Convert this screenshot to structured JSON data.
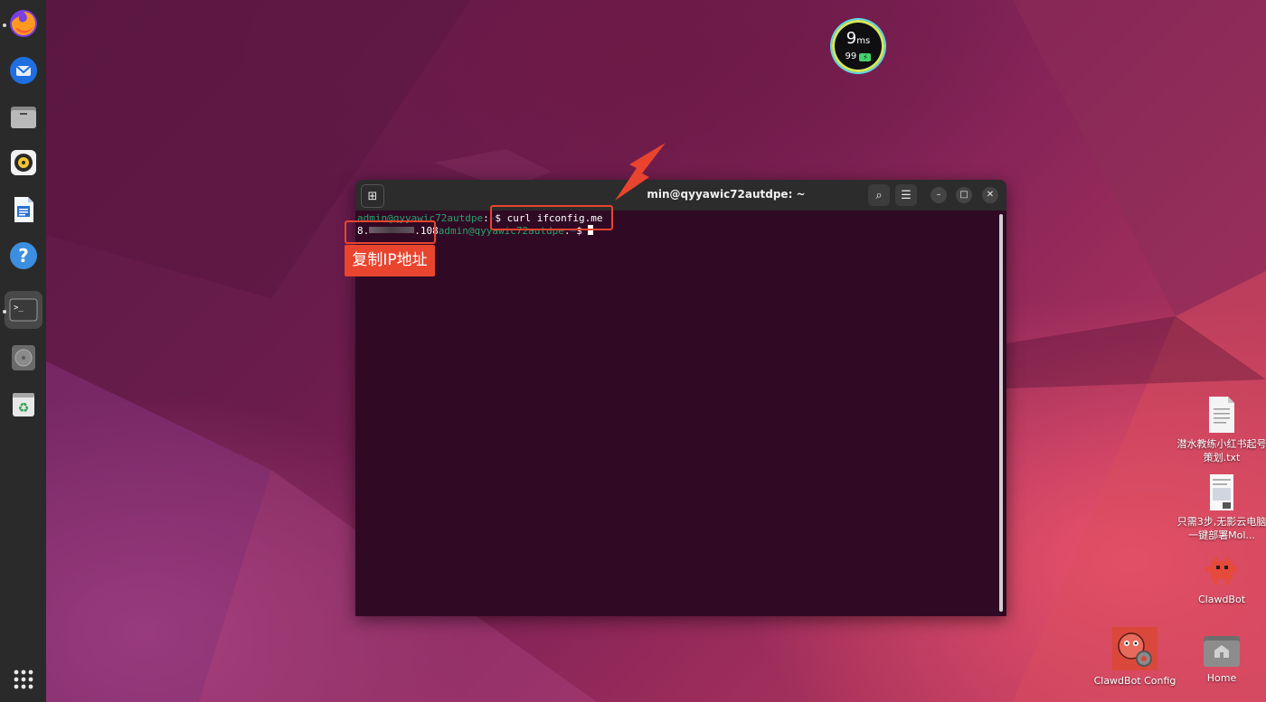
{
  "dock": {
    "apps": [
      {
        "name": "Firefox",
        "icon": "firefox-icon",
        "running": true
      },
      {
        "name": "Thunderbird",
        "icon": "thunderbird-icon",
        "running": false
      },
      {
        "name": "Files",
        "icon": "files-icon",
        "running": false
      },
      {
        "name": "Rhythmbox",
        "icon": "rhythmbox-icon",
        "running": false
      },
      {
        "name": "LibreOffice Writer",
        "icon": "writer-icon",
        "running": false
      },
      {
        "name": "Help",
        "icon": "help-icon",
        "running": false
      },
      {
        "name": "Terminal",
        "icon": "terminal-icon",
        "running": true,
        "active": true
      },
      {
        "name": "Disc",
        "icon": "disc-icon",
        "running": false
      },
      {
        "name": "Trash",
        "icon": "trash-icon",
        "running": false
      }
    ],
    "show_apps_icon": "grid-icon",
    "help_glyph": "?",
    "terminal_glyph": ">_",
    "trash_glyph": "♻"
  },
  "speed_widget": {
    "ping_value": "9",
    "ping_unit": "ms",
    "battery": "99",
    "battery_glyph": "⚡"
  },
  "terminal": {
    "title": "admin@qyyawic72autdpe: ~",
    "title_visible": "min@qyyawic72autdpe: ~",
    "line1": {
      "user_host": "admin@qyyawic72autdpe",
      "sep": ":",
      "path": "~",
      "dollar": "$ ",
      "command": "curl ifconfig.me"
    },
    "line2": {
      "ip_prefix": "8.",
      "ip_suffix": ".108",
      "user_host": "admin@qyyawic72autdpe",
      "sep": ":",
      "path": "~",
      "dollar": "$ "
    },
    "buttons": {
      "new_tab": "⊞",
      "search": "⌕",
      "menu": "☰",
      "minimize": "–",
      "maximize": "□",
      "close": "✕"
    }
  },
  "annotation": {
    "copy_ip_label": "复制IP地址",
    "accent": "#e8442e"
  },
  "desktop_icons": [
    {
      "label": "潜水教练小红书起号策划.txt",
      "icon": "text-file-icon"
    },
    {
      "label": "只需3步,无影云电脑一键部署Mol...",
      "icon": "document-image-icon"
    },
    {
      "label": "ClawdBot",
      "icon": "clawdbot-icon"
    },
    {
      "label": "ClawdBot Config",
      "icon": "clawdbot-config-icon"
    },
    {
      "label": "Home",
      "icon": "home-folder-icon"
    }
  ]
}
